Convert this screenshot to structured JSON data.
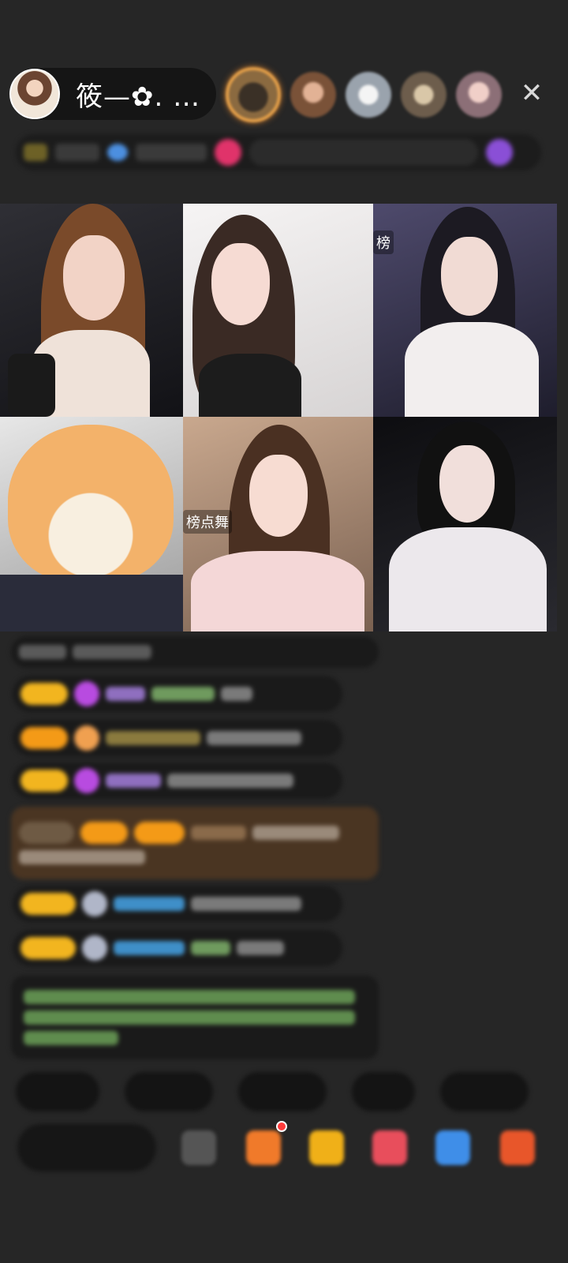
{
  "host": {
    "name": "筱—✿. …"
  },
  "viewers": [
    "viewer-avatar-1",
    "viewer-avatar-2",
    "viewer-avatar-3",
    "viewer-avatar-4",
    "viewer-avatar-5"
  ],
  "close_icon": "✕",
  "grid": {
    "tile_labels": {
      "tile3": "榜",
      "tile5": "榜点舞"
    }
  },
  "icons": {
    "close": "close-icon",
    "gift": "gift-icon",
    "emoji": "emoji-icon"
  },
  "colors": {
    "background": "#262626",
    "badge_gold": "#f2b51f",
    "badge_orange": "#f49a17",
    "rank1_ring": "#e8a24a",
    "username_purple": "#c39af0",
    "username_blue": "#4fb7ff",
    "system_green": "#9ee07a"
  }
}
